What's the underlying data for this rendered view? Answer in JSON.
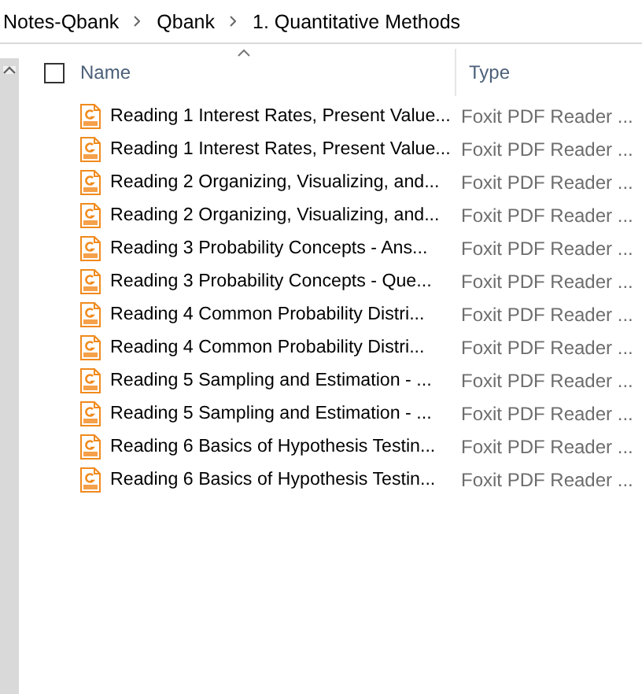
{
  "breadcrumb": [
    "Notes-Qbank",
    "Qbank",
    "1. Quantitative Methods"
  ],
  "columns": [
    {
      "label": "Name",
      "sorted": true
    },
    {
      "label": "Type",
      "sorted": false
    }
  ],
  "select_all": {
    "checked": false
  },
  "files": [
    {
      "name": "Reading 1 Interest Rates, Present Value...",
      "type": "Foxit PDF Reader ..."
    },
    {
      "name": "Reading 1 Interest Rates, Present Value...",
      "type": "Foxit PDF Reader ..."
    },
    {
      "name": "Reading 2 Organizing, Visualizing, and...",
      "type": "Foxit PDF Reader ..."
    },
    {
      "name": "Reading 2 Organizing, Visualizing, and...",
      "type": "Foxit PDF Reader ..."
    },
    {
      "name": "Reading 3 Probability Concepts - Ans...",
      "type": "Foxit PDF Reader ..."
    },
    {
      "name": "Reading 3 Probability Concepts - Que...",
      "type": "Foxit PDF Reader ..."
    },
    {
      "name": "Reading 4 Common Probability Distri...",
      "type": "Foxit PDF Reader ..."
    },
    {
      "name": "Reading 4 Common Probability Distri...",
      "type": "Foxit PDF Reader ..."
    },
    {
      "name": "Reading 5 Sampling and Estimation - ...",
      "type": "Foxit PDF Reader ..."
    },
    {
      "name": "Reading 5 Sampling and Estimation - ...",
      "type": "Foxit PDF Reader ..."
    },
    {
      "name": "Reading 6 Basics of Hypothesis Testin...",
      "type": "Foxit PDF Reader ..."
    },
    {
      "name": "Reading 6 Basics of Hypothesis Testin...",
      "type": "Foxit PDF Reader ..."
    }
  ]
}
